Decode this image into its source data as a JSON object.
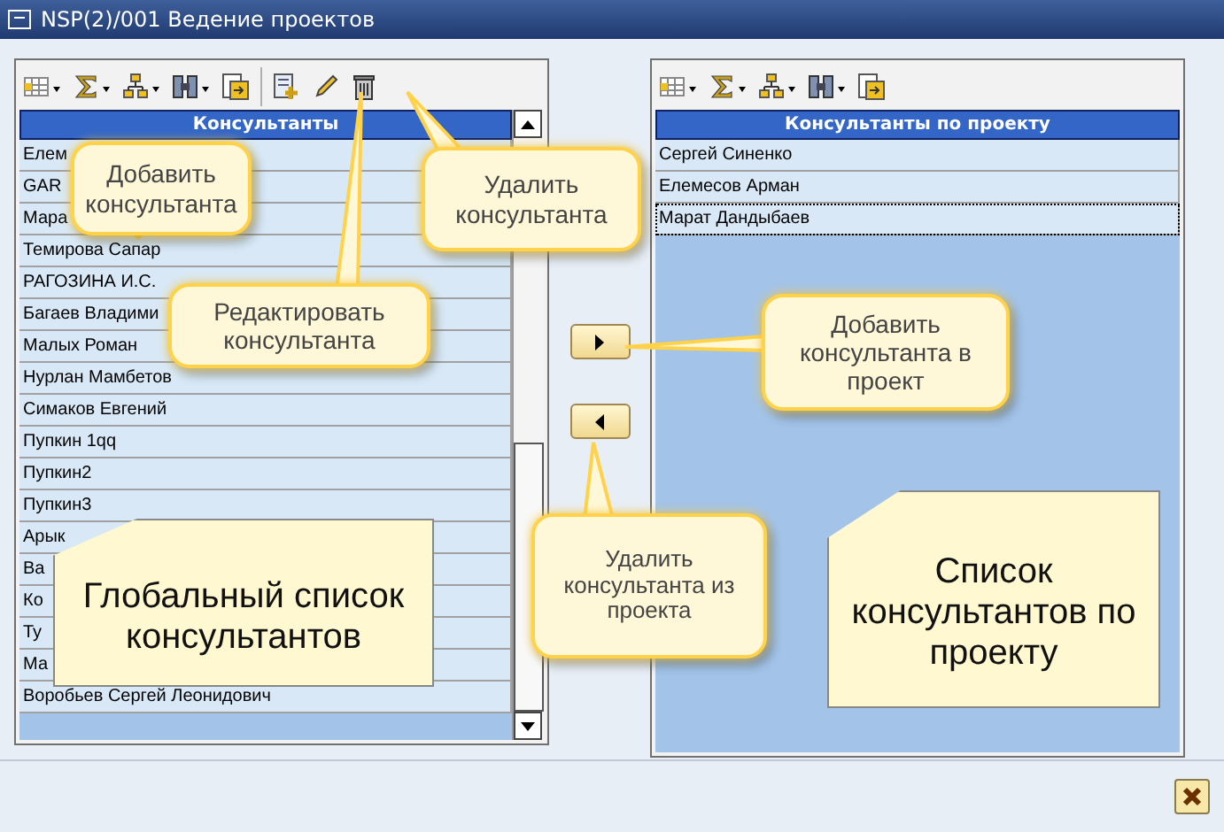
{
  "window": {
    "title": "NSP(2)/001 Ведение проектов"
  },
  "left_panel": {
    "header": "Консультанты",
    "rows": [
      {
        "name": "Елем"
      },
      {
        "name": "GAR"
      },
      {
        "name": "Мара"
      },
      {
        "name": "Темирова Сапар"
      },
      {
        "name": "РАГОЗИНА И.С."
      },
      {
        "name": "Багаев Владими"
      },
      {
        "name": "Малых Роман"
      },
      {
        "name": "Нурлан Мамбетов"
      },
      {
        "name": "Симаков Евгений"
      },
      {
        "name": "Пупкин 1qq"
      },
      {
        "name": "Пупкин2"
      },
      {
        "name": "Пупкин3"
      },
      {
        "name": "Арык"
      },
      {
        "name": "Ва"
      },
      {
        "name": "Ко"
      },
      {
        "name": "Ту"
      },
      {
        "name": "Ма"
      },
      {
        "name": "Воробьев Сергей Леонидович"
      }
    ]
  },
  "right_panel": {
    "header": "Консультанты по проекту",
    "rows": [
      {
        "name": "Сергей Синенко",
        "selected": false
      },
      {
        "name": "Елемесов Арман",
        "selected": false
      },
      {
        "name": "Марат Дандыбаев",
        "selected": true
      }
    ]
  },
  "callouts": [
    {
      "text": "Добавить консультанта"
    },
    {
      "text": "Удалить консультанта"
    },
    {
      "text": "Редактировать консультанта"
    },
    {
      "text": "Добавить консультанта в проект"
    },
    {
      "text": "Удалить консультанта из проекта"
    }
  ],
  "notes": [
    {
      "text": "Глобальный список консультантов"
    },
    {
      "text": "Список консультантов по проекту"
    }
  ]
}
